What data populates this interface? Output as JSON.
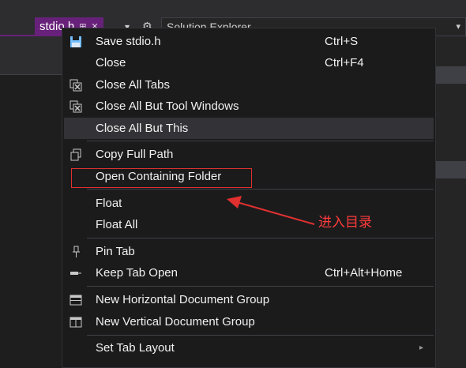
{
  "tab": {
    "filename": "stdio.h",
    "pin_glyph": "⊞",
    "close_glyph": "✕"
  },
  "toolbar": {
    "overflow_glyph": "▾",
    "settings_glyph": "⚙"
  },
  "solution_explorer": {
    "title": "Solution Explorer",
    "dropdown_glyph": "▾"
  },
  "menu": {
    "items": [
      {
        "label": "Save stdio.h",
        "shortcut": "Ctrl+S",
        "icon": "floppy-disk-icon"
      },
      {
        "label": "Close",
        "shortcut": "Ctrl+F4"
      },
      {
        "label": "Close All Tabs",
        "icon": "close-all-tabs-icon"
      },
      {
        "label": "Close All But Tool Windows",
        "icon": "close-but-tool-windows-icon"
      },
      {
        "label": "Close All But This",
        "state": "hovered"
      },
      {
        "label": "Copy Full Path",
        "icon": "copy-icon"
      },
      {
        "label": "Open Containing Folder"
      },
      {
        "label": "Float"
      },
      {
        "label": "Float All"
      },
      {
        "label": "Pin Tab",
        "icon": "pin-icon"
      },
      {
        "label": "Keep Tab Open",
        "shortcut": "Ctrl+Alt+Home",
        "icon": "keep-open-icon"
      },
      {
        "label": "New Horizontal Document Group",
        "icon": "horizontal-split-icon"
      },
      {
        "label": "New Vertical Document Group",
        "icon": "vertical-split-icon"
      },
      {
        "label": "Set Tab Layout",
        "submenu_glyph": "▸"
      }
    ]
  },
  "annotation": {
    "text": "进入目录",
    "color": "#ff3b3b"
  },
  "colors": {
    "accent": "#68217a",
    "menu_bg": "#1b1b1c",
    "hover": "#333337",
    "text": "#f1f1f1"
  }
}
